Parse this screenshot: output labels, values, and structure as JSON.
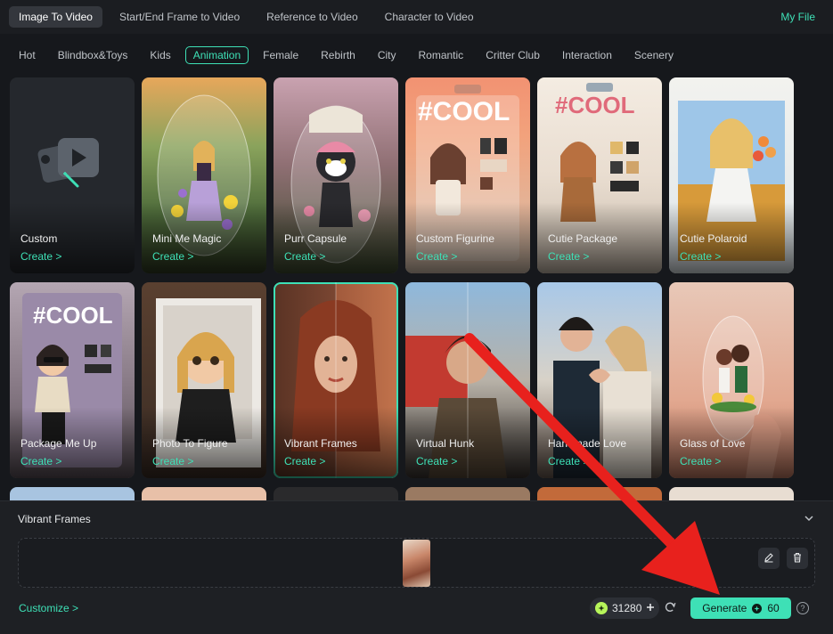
{
  "top_tabs": [
    {
      "label": "Image To Video",
      "active": true
    },
    {
      "label": "Start/End Frame to Video",
      "active": false
    },
    {
      "label": "Reference to Video",
      "active": false
    },
    {
      "label": "Character to Video",
      "active": false
    }
  ],
  "my_file_label": "My File",
  "categories": [
    {
      "label": "Hot",
      "active": false
    },
    {
      "label": "Blindbox&Toys",
      "active": false
    },
    {
      "label": "Kids",
      "active": false
    },
    {
      "label": "Animation",
      "active": true
    },
    {
      "label": "Female",
      "active": false
    },
    {
      "label": "Rebirth",
      "active": false
    },
    {
      "label": "City",
      "active": false
    },
    {
      "label": "Romantic",
      "active": false
    },
    {
      "label": "Critter Club",
      "active": false
    },
    {
      "label": "Interaction",
      "active": false
    },
    {
      "label": "Scenery",
      "active": false
    }
  ],
  "create_label": "Create >",
  "cards_row1": [
    {
      "title": "Custom"
    },
    {
      "title": "Mini Me Magic"
    },
    {
      "title": "Purr Capsule"
    },
    {
      "title": "Custom Figurine",
      "banner": "#COOL"
    },
    {
      "title": "Cutie Package",
      "banner": "#COOL"
    },
    {
      "title": "Cutie Polaroid"
    }
  ],
  "cards_row2": [
    {
      "title": "Package Me Up",
      "banner": "#COOL"
    },
    {
      "title": "Photo To Figure"
    },
    {
      "title": "Vibrant Frames",
      "selected": true
    },
    {
      "title": "Virtual Hunk"
    },
    {
      "title": "Handmade Love"
    },
    {
      "title": "Glass of Love"
    }
  ],
  "panel": {
    "title": "Vibrant Frames",
    "customize_label": "Customize >",
    "credits": "31280",
    "generate_label": "Generate",
    "generate_cost": "60"
  },
  "colors": {
    "accent": "#3ee0b6",
    "arrow": "#e8211d"
  }
}
